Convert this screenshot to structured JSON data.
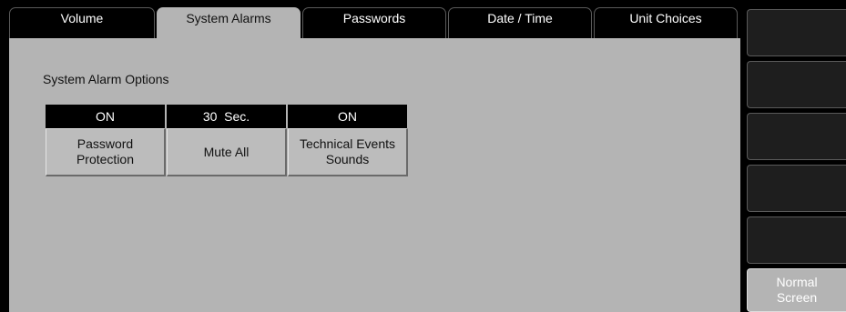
{
  "tabs": [
    {
      "label": "Volume"
    },
    {
      "label": "System Alarms"
    },
    {
      "label": "Passwords"
    },
    {
      "label": "Date / Time"
    },
    {
      "label": "Unit Choices"
    }
  ],
  "active_tab": "System Alarms",
  "section_title": "System Alarm Options",
  "options": [
    {
      "value": "ON",
      "label": "Password\nProtection"
    },
    {
      "value": "30  Sec.",
      "label": "Mute All"
    },
    {
      "value": "ON",
      "label": "Technical Events\nSounds"
    }
  ],
  "side_buttons": {
    "normal_screen_label": "Normal\nScreen"
  },
  "colors": {
    "panel": "#b4b4b4",
    "background": "#000000",
    "value_bar": "#000000"
  }
}
